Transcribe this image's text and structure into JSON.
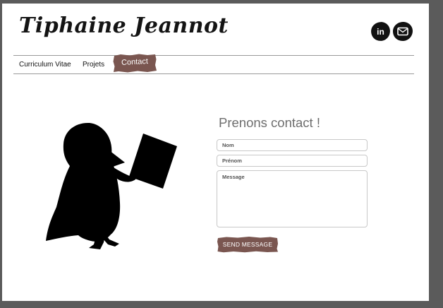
{
  "site": {
    "title": "Tiphaine Jeannot"
  },
  "social": {
    "linkedin_label": "in"
  },
  "nav": {
    "items": [
      {
        "label": "Curriculum Vitae"
      },
      {
        "label": "Projets"
      },
      {
        "label": "Contact"
      }
    ],
    "active_color": "#7a5650"
  },
  "contact": {
    "title": "Prenons contact !",
    "fields": {
      "nom_placeholder": "Nom",
      "prenom_placeholder": "Prénom",
      "message_placeholder": "Message"
    },
    "submit_label": "SEND MESSAGE"
  },
  "illustration": {
    "icon": "bird-reading-book-icon"
  }
}
